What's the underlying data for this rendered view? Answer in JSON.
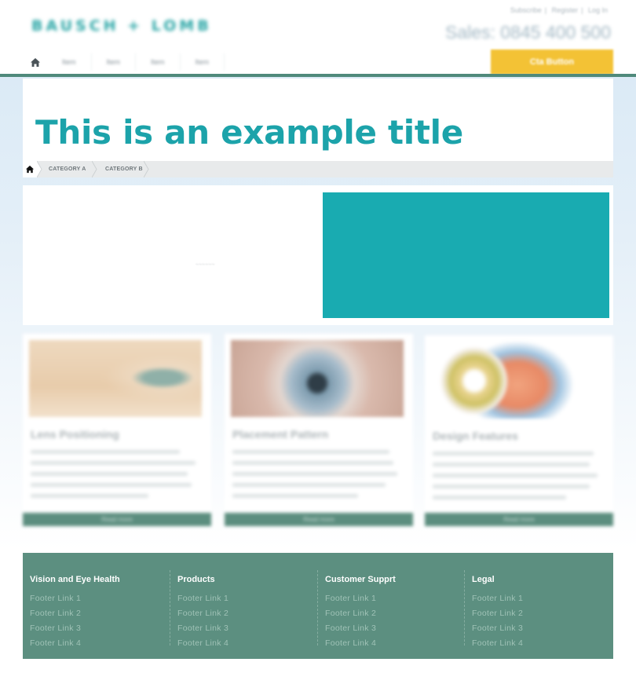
{
  "header": {
    "logo": "BAUSCH + LOMB",
    "top_links": [
      "Subscribe",
      "Register",
      "Log In"
    ],
    "phone": "Sales: 0845 400 500",
    "nav_items": [
      "Item",
      "Item",
      "Item",
      "Item"
    ],
    "cta_label": "Cta Button"
  },
  "page": {
    "title": "This is an example title"
  },
  "breadcrumb": {
    "items": [
      "CATEGORY A",
      "CATEGORY B"
    ]
  },
  "hero": {
    "smudge_text": "~~~~~~",
    "panel_color": "#19abb1"
  },
  "cards": [
    {
      "title": "Lens Positioning",
      "button": "Read more",
      "image": "eye-closeup"
    },
    {
      "title": "Placement Pattern",
      "button": "Read more",
      "image": "iris-closeup"
    },
    {
      "title": "Design Features",
      "button": "Read more",
      "image": "eye-anatomy-diagram"
    }
  ],
  "footer": {
    "columns": [
      {
        "heading": "Vision and Eye Health",
        "links": [
          "Footer Link 1",
          "Footer Link 2",
          "Footer Link 3",
          "Footer Link 4"
        ]
      },
      {
        "heading": "Products",
        "links": [
          "Footer Link 1",
          "Footer Link 2",
          "Footer Link 3",
          "Footer Link 4"
        ]
      },
      {
        "heading": "Customer Supprt",
        "links": [
          "Footer Link 1",
          "Footer Link 2",
          "Footer Link 3",
          "Footer Link 4"
        ]
      },
      {
        "heading": "Legal",
        "links": [
          "Footer Link 1",
          "Footer Link 2",
          "Footer Link 3",
          "Footer Link 4"
        ]
      }
    ]
  },
  "colors": {
    "brand_teal": "#1ca3aa",
    "footer_green": "#5c8f80",
    "cta_yellow": "#f3c235"
  }
}
